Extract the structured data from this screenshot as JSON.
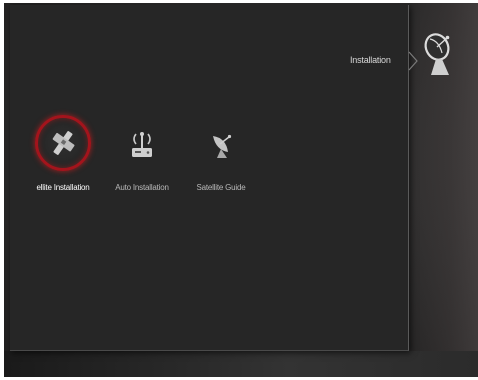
{
  "breadcrumb": {
    "label": "Installation"
  },
  "section_icon": "satellite-dish-icon",
  "menu": {
    "items": [
      {
        "label": "ellite Installation",
        "icon": "satellite-icon",
        "selected": true
      },
      {
        "label": "Auto Installation",
        "icon": "antenna-receiver-icon",
        "selected": false
      },
      {
        "label": "Satellite Guide",
        "icon": "satellite-dish-icon",
        "selected": false
      }
    ]
  },
  "colors": {
    "background": "#262626",
    "selection_ring": "#a3141c",
    "text": "#d8d8d8"
  }
}
